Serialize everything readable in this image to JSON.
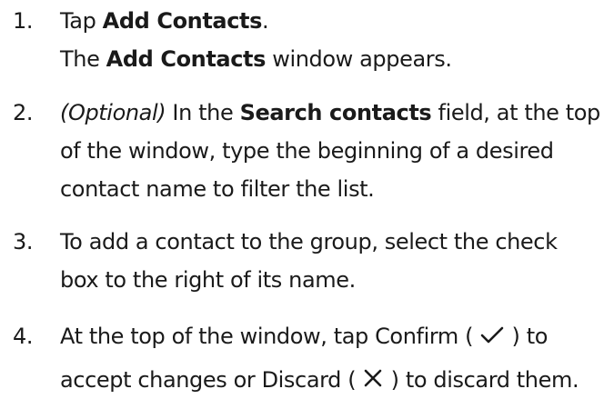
{
  "steps": [
    {
      "number": "1.",
      "l1_a": "Tap ",
      "l1_b": "Add Contacts",
      "l1_c": ".",
      "l2_a": "The ",
      "l2_b": "Add Contacts",
      "l2_c": " window appears."
    },
    {
      "number": "2.",
      "l1_a": "(Optional)",
      "l1_b": " In the ",
      "l1_c": "Search contacts",
      "l1_d": " field, at the top",
      "l2": "of the window, type the beginning of a desired",
      "l3": "contact name to filter the list."
    },
    {
      "number": "3.",
      "l1": "To add a contact to the group, select the check",
      "l2": "box to the right of its name."
    },
    {
      "number": "4.",
      "l1_a": "At the top of the window, tap Confirm ( ",
      "l1_b": " ) to",
      "l2_a": "accept changes or Discard ( ",
      "l2_b": " ) to discard them."
    }
  ],
  "icons": {
    "confirm": "checkmark-icon",
    "discard": "close-icon"
  }
}
